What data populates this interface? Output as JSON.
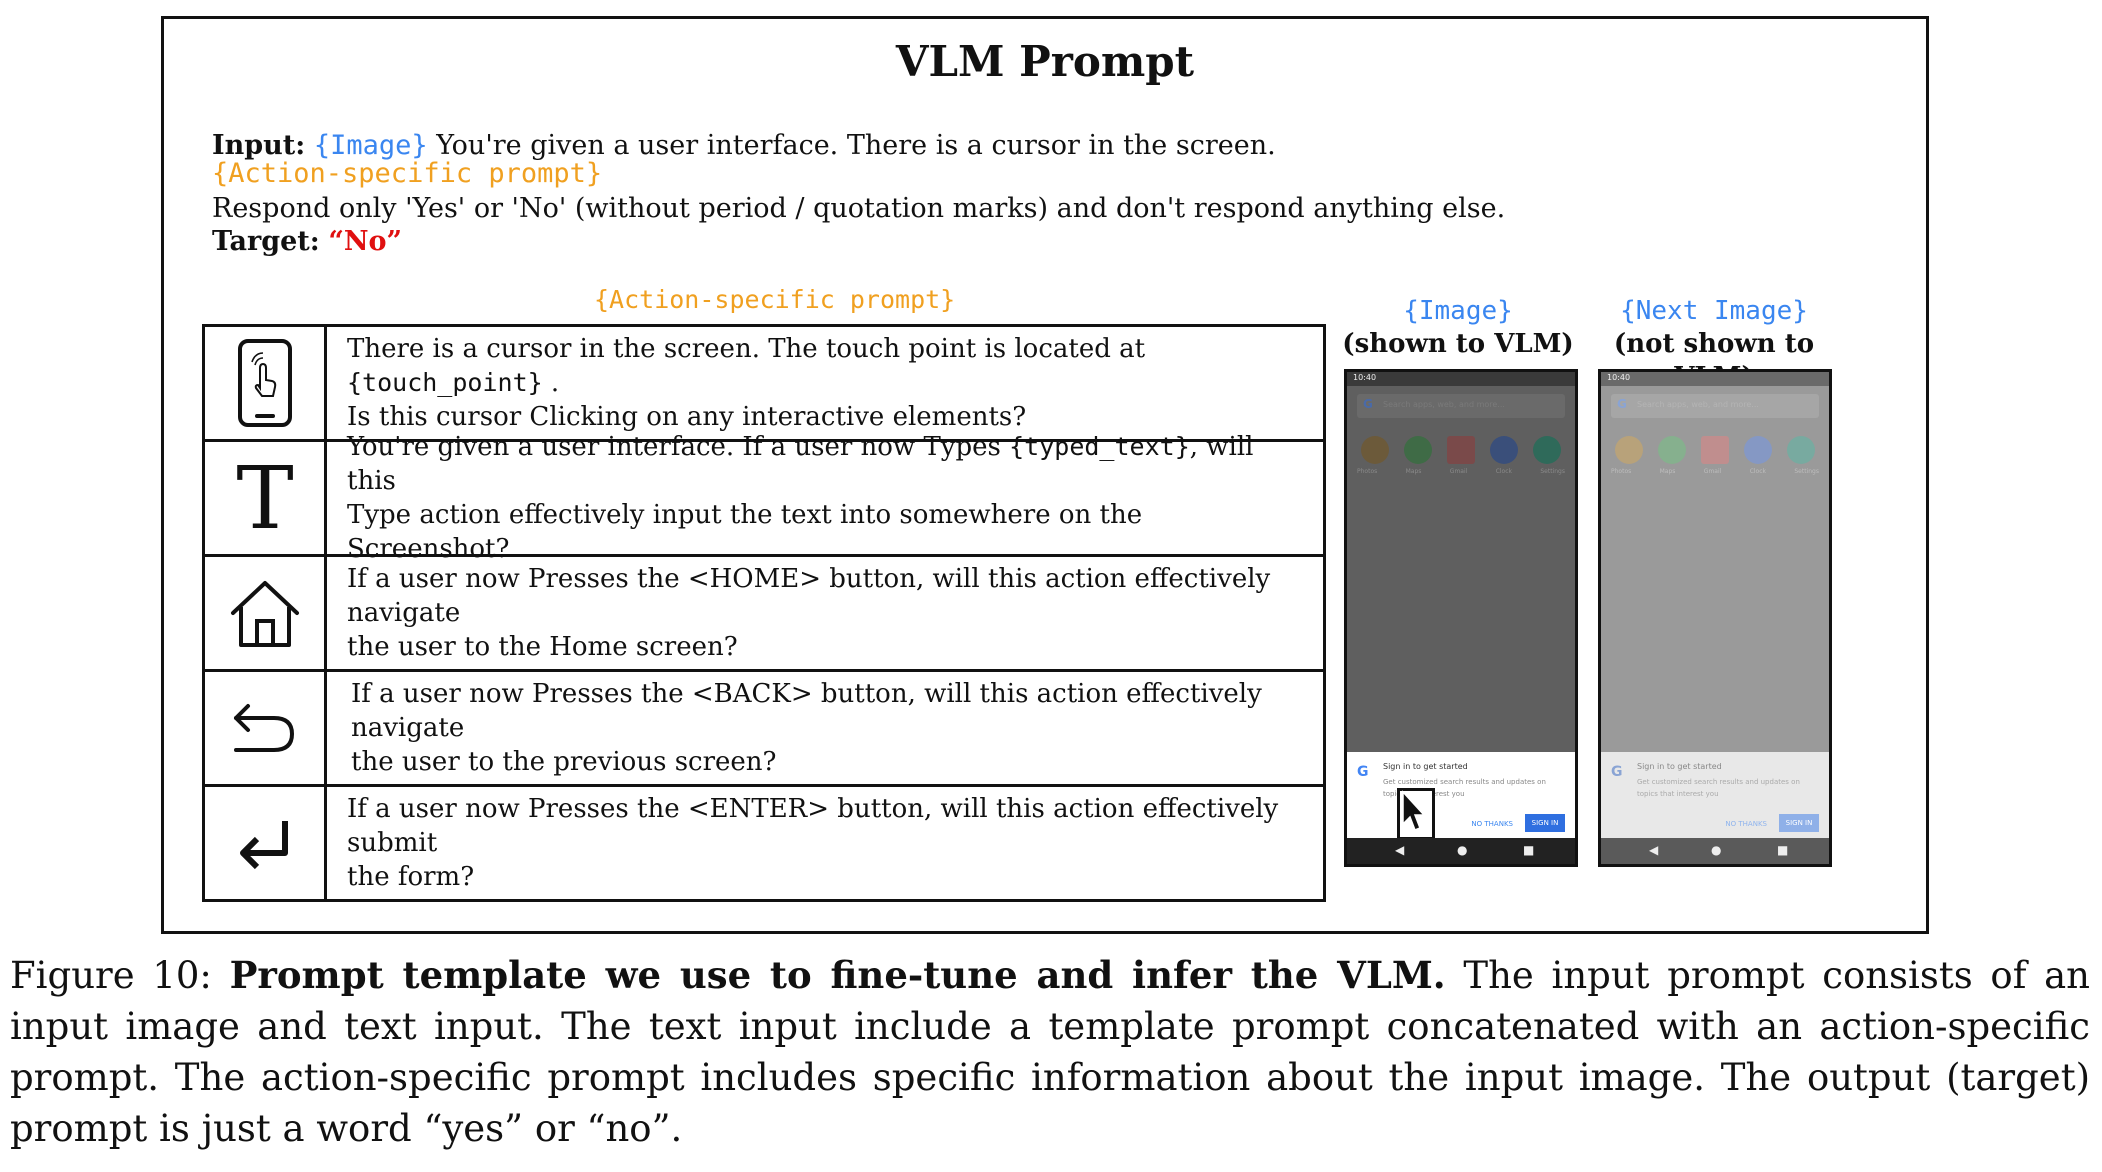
{
  "box": {
    "title": "VLM Prompt",
    "input_label": "Input:",
    "image_token": "{Image}",
    "input_text": "You're given a user interface. There is a cursor in the screen.",
    "action_token": "{Action-specific prompt}",
    "respond_text": "Respond only 'Yes' or 'No' (without period / quotation marks) and don't respond anything else.",
    "target_label": "Target:",
    "target_value": "“No”"
  },
  "table": {
    "title": "{Action-specific prompt}",
    "rows": [
      {
        "icon": "phone-touch-icon",
        "line1_pre": "There is a cursor in the screen. The touch point is located at ",
        "line1_code": "{touch_point}",
        "line1_post": " .",
        "line2": "Is this cursor Clicking on any interactive elements?"
      },
      {
        "icon": "type-t-icon",
        "line1_pre": "You're given a user interface. If a user now Types ",
        "line1_code": "{typed_text}",
        "line1_post": ", will this",
        "line2": "Type action effectively input the text into somewhere on the Screenshot?"
      },
      {
        "icon": "home-icon",
        "line1_pre": "If a user now Presses the <HOME> button, will this action effectively navigate",
        "line1_code": "",
        "line1_post": "",
        "line2": "the user to the Home screen?"
      },
      {
        "icon": "back-arrow-icon",
        "line1_pre": "If a user now Presses the <BACK> button, will this action effectively navigate",
        "line1_code": "",
        "line1_post": "",
        "line2": "the user to the previous screen?"
      },
      {
        "icon": "enter-icon",
        "line1_pre": "If a user now Presses the <ENTER> button, will this action effectively submit",
        "line1_code": "",
        "line1_post": "",
        "line2": "the form?"
      }
    ]
  },
  "screenshots": [
    {
      "token": "{Image}",
      "caption": "(shown to VLM)",
      "status_time": "10:40",
      "search_placeholder": "Search apps, web, and more...",
      "app_labels": [
        "Photos",
        "Maps",
        "Gmail",
        "Clock",
        "Settings"
      ],
      "sheet_title": "Sign in to get started",
      "sheet_body": "Get customized search results and updates on topics that interest you",
      "no_thanks": "NO THANKS",
      "sign_in": "SIGN IN",
      "g_letter": "G",
      "dimmed": true,
      "cursor": true
    },
    {
      "token": "{Next Image}",
      "caption": "(not shown to VLM)",
      "status_time": "10:40",
      "search_placeholder": "Search apps, web, and more...",
      "app_labels": [
        "Photos",
        "Maps",
        "Gmail",
        "Clock",
        "Settings"
      ],
      "sheet_title": "Sign in to get started",
      "sheet_body": "Get customized search results and updates on topics that interest you",
      "no_thanks": "NO THANKS",
      "sign_in": "SIGN IN",
      "g_letter": "G",
      "dimmed": false,
      "cursor": false
    }
  ],
  "caption": {
    "label": "Figure",
    "number": "10:",
    "bold": "Prompt template we use to fine-tune and infer the VLM.",
    "rest": "The input prompt consists of an input image and text input. The text input include a template prompt concatenated with an action-specific prompt. The action-specific prompt includes specific information about the input image. The output (target) prompt is just a word “yes” or “no”."
  },
  "colors": {
    "token_blue": "#3a86f0",
    "token_orange": "#f0a020",
    "target_red": "#e01010"
  }
}
